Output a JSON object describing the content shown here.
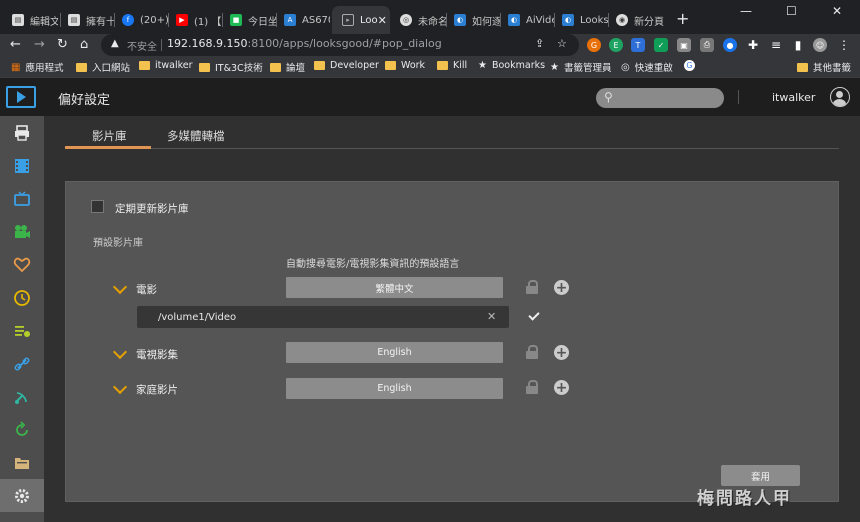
{
  "browser": {
    "tabs": [
      {
        "title": "編輯文",
        "favicon": "page-icon"
      },
      {
        "title": "擁有十",
        "favicon": "page-icon"
      },
      {
        "title": "(20+) I",
        "favicon": "facebook-icon"
      },
      {
        "title": "(1) 【F",
        "favicon": "youtube-icon"
      },
      {
        "title": "今日坐",
        "favicon": "green-app-icon"
      },
      {
        "title": "AS670",
        "favicon": "asustor-icon"
      },
      {
        "title": "Loo",
        "favicon": "looksgood-icon",
        "active": true
      },
      {
        "title": "未命名",
        "favicon": "globe-icon"
      },
      {
        "title": "如何逐",
        "favicon": "asustor-icon"
      },
      {
        "title": "AiVide",
        "favicon": "asustor-icon"
      },
      {
        "title": "Looks",
        "favicon": "asustor-icon"
      },
      {
        "title": "新分頁",
        "favicon": "chrome-icon"
      }
    ],
    "tab_close": "✕",
    "new_tab": "+",
    "window_controls": {
      "minimize": "—",
      "maximize": "☐",
      "close": "✕"
    },
    "address": {
      "security_label": "不安全",
      "url_host": "192.168.9.150",
      "url_rest": ":8100/apps/looksgood/#pop_dialog"
    },
    "bookmarks": [
      {
        "label": "應用程式",
        "icon": "apps-grid-icon"
      },
      {
        "label": "入口網站",
        "icon": "folder-icon"
      },
      {
        "label": "itwalker",
        "icon": "folder-icon"
      },
      {
        "label": "IT&3C技術",
        "icon": "folder-icon"
      },
      {
        "label": "論壇",
        "icon": "folder-icon"
      },
      {
        "label": "Developer",
        "icon": "folder-icon"
      },
      {
        "label": "Work",
        "icon": "folder-icon"
      },
      {
        "label": "Kill",
        "icon": "folder-icon"
      },
      {
        "label": "Bookmarks",
        "icon": "star-icon"
      },
      {
        "label": "書籤管理員",
        "icon": "star-icon"
      },
      {
        "label": "快速重啟",
        "icon": "globe-icon"
      },
      {
        "label": "其他書籤",
        "icon": "folder-icon"
      }
    ]
  },
  "app": {
    "title": "偏好設定",
    "user": "itwalker",
    "accent_color": "#e09552",
    "sidebar_items": [
      "printer-icon",
      "film-icon",
      "tv-icon",
      "camcorder-icon",
      "heart-icon",
      "clock-icon",
      "playlist-icon",
      "link-icon",
      "satellite-icon",
      "refresh-icon",
      "folder-icon",
      "gear-icon"
    ],
    "tabs": [
      {
        "label": "影片庫",
        "active": true
      },
      {
        "label": "多媒體轉檔",
        "active": false
      }
    ],
    "settings": {
      "auto_update_label": "定期更新影片庫",
      "auto_update_checked": false,
      "default_library_label": "預設影片庫",
      "language_header": "自動搜尋電影/電視影集資訊的預設語言",
      "categories": [
        {
          "name": "電影",
          "language": "繁體中文"
        },
        {
          "name": "電視影集",
          "language": "English"
        },
        {
          "name": "家庭影片",
          "language": "English"
        }
      ],
      "movie_path": "/volume1/Video",
      "apply_label": "套用"
    },
    "watermark": "梅問路人甲"
  }
}
